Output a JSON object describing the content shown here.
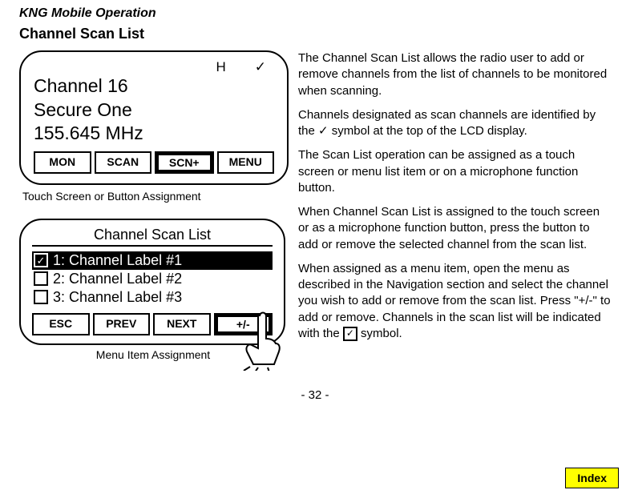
{
  "header": {
    "doc_title": "KNG Mobile Operation",
    "section_title": "Channel Scan List"
  },
  "lcd1": {
    "indicator_h": "H",
    "indicator_check": "✓",
    "line1": "Channel 16",
    "line2": "Secure One",
    "line3": "155.645 MHz",
    "softkeys": {
      "k1": "MON",
      "k2": "SCAN",
      "k3": "SCN+",
      "k4": "MENU"
    },
    "caption": "Touch Screen or Button Assignment"
  },
  "lcd2": {
    "title": "Channel Scan List",
    "items": [
      {
        "label": "1: Channel Label #1",
        "checked": true,
        "selected": true
      },
      {
        "label": "2: Channel Label #2",
        "checked": false,
        "selected": false
      },
      {
        "label": "3: Channel Label #3",
        "checked": false,
        "selected": false
      }
    ],
    "softkeys": {
      "k1": "ESC",
      "k2": "PREV",
      "k3": "NEXT",
      "k4": "+/-"
    },
    "caption": "Menu Item Assignment"
  },
  "body": {
    "p1": "The Channel Scan List allows the radio user to add or remove channels from the list of channels to be monitored when scanning.",
    "p2a": "Channels designated as scan channels are identified by the ",
    "p2_check": "✓",
    "p2b": " symbol at the top of the LCD display.",
    "p3": "The Scan List operation can be assigned as a touch screen or menu list item or on a microphone function button.",
    "p4": "When Channel Scan List is assigned to the touch screen or as a microphone function button, press the button to add or remove the selected channel from the scan list.",
    "p5a": "When assigned as a menu item, open the menu as described in the Navigation section and select the channel you wish to add or remove from the scan list. Press \"+/-\" to add or remove. Channels in the scan list will be indicated with the ",
    "p5_box": "✓",
    "p5b": " symbol."
  },
  "footer": {
    "page_number": "- 32 -",
    "index_label": "Index"
  }
}
